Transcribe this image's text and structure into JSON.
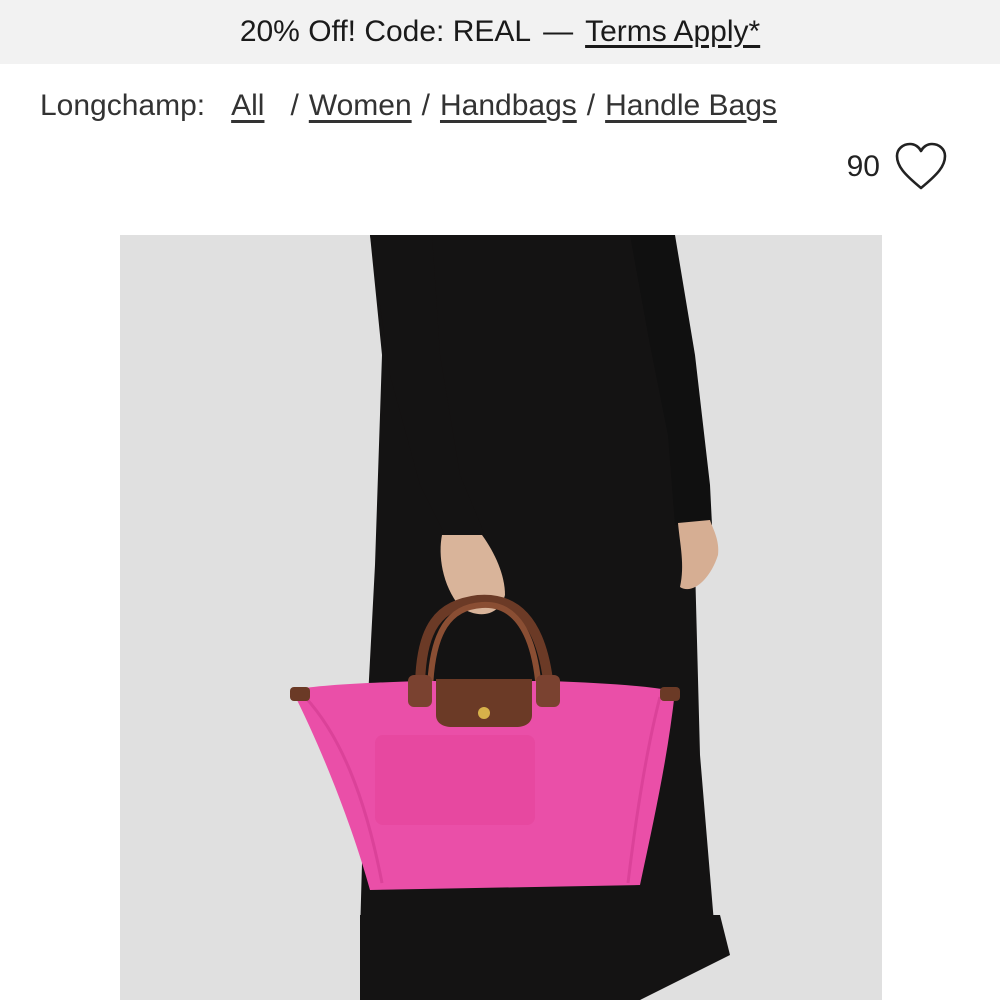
{
  "promo": {
    "text": "20% Off! Code: REAL",
    "separator": "—",
    "terms_label": "Terms Apply*"
  },
  "breadcrumb": {
    "brand": "Longchamp:",
    "items": [
      {
        "label": "All"
      },
      {
        "label": "Women"
      },
      {
        "label": "Handbags"
      },
      {
        "label": "Handle Bags"
      }
    ],
    "separator": "/"
  },
  "favorites": {
    "count": "90",
    "icon": "heart-outline-icon"
  },
  "product_image": {
    "subject": "pink nylon handle bag with brown leather handles held by model in black knit dress",
    "colors": {
      "background": "#e0e0e0",
      "dress": "#141313",
      "bag": "#ea4fa8",
      "leather": "#6b3a26"
    }
  }
}
